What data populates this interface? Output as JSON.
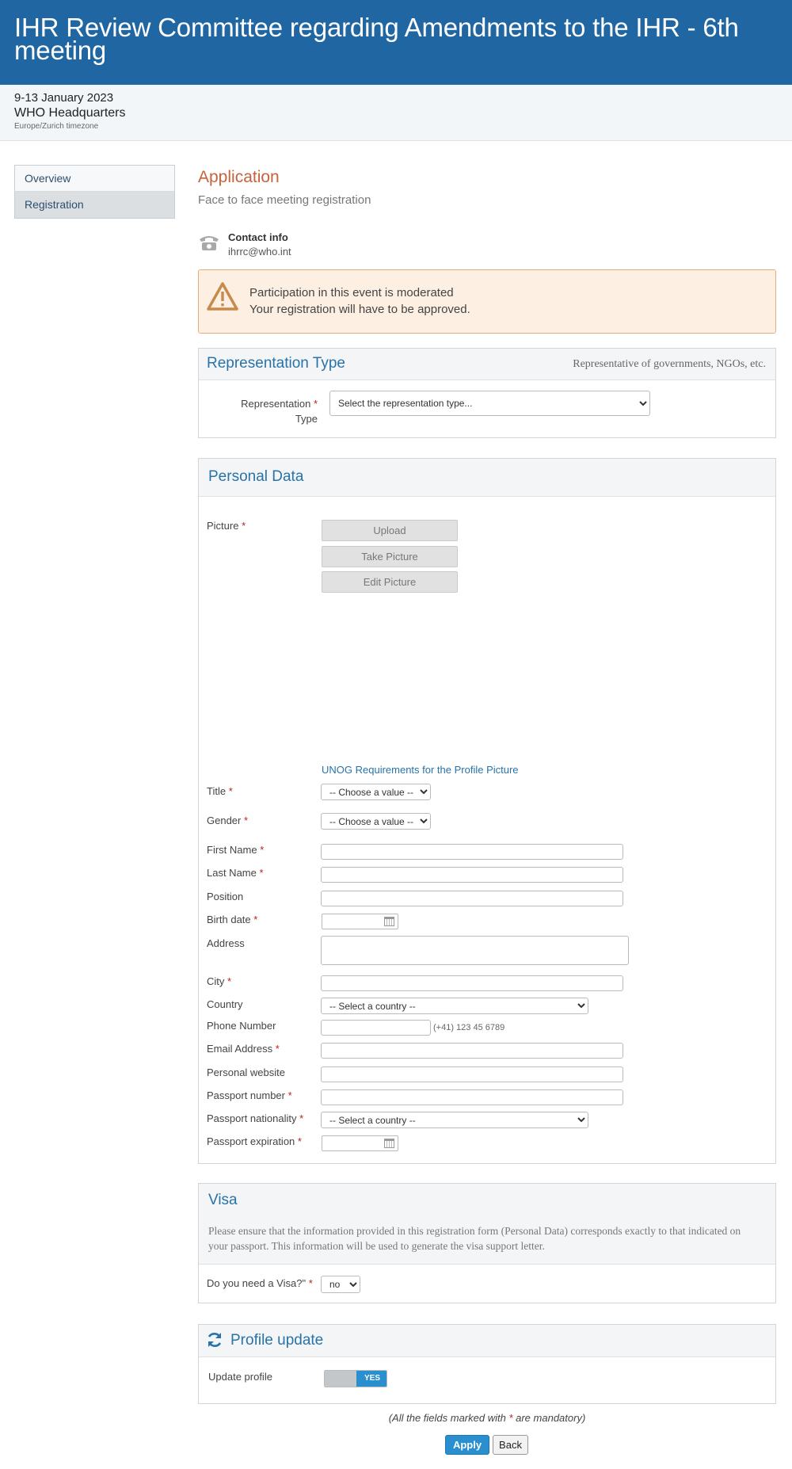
{
  "header": {
    "title": "IHR Review Committee regarding Amendments to the IHR - 6th meeting",
    "dates": "9-13 January 2023",
    "venue": "WHO Headquarters",
    "timezone": "Europe/Zurich timezone"
  },
  "sidebar": {
    "items": [
      {
        "label": "Overview",
        "active": false
      },
      {
        "label": "Registration",
        "active": true
      }
    ]
  },
  "main": {
    "title": "Application",
    "subtitle": "Face to face meeting registration",
    "contact": {
      "label": "Contact info",
      "email": "ihrrc@who.int"
    },
    "notice": {
      "line1": "Participation in this event is moderated",
      "line2": "Your registration will have to be approved."
    }
  },
  "representation": {
    "title": "Representation Type",
    "note": "Representative of governments, NGOs, etc.",
    "field_label": "Representation",
    "field_label2": "Type",
    "select_value": "Select the representation type..."
  },
  "personal": {
    "title": "Personal Data",
    "picture_label": "Picture",
    "upload": "Upload",
    "take_picture": "Take Picture",
    "edit_picture": "Edit Picture",
    "requirements_link": "UNOG Requirements for the Profile Picture",
    "title_label": "Title",
    "gender_label": "Gender",
    "choose_value": "-- Choose a value --",
    "first_name": "First Name",
    "last_name": "Last Name",
    "position": "Position",
    "birth_date": "Birth date",
    "address": "Address",
    "city": "City",
    "country": "Country",
    "select_country": "-- Select a country --",
    "phone": "Phone Number",
    "phone_hint": "(+41) 123 45 6789",
    "email": "Email Address",
    "website": "Personal website",
    "passport_number": "Passport number",
    "passport_nationality": "Passport nationality",
    "passport_expiration": "Passport expiration"
  },
  "visa": {
    "title": "Visa",
    "note": "Please ensure that the information provided in this registration form (Personal Data) corresponds exactly to that indicated on your passport. This information will be used to generate the visa support letter.",
    "question": "Do you need a Visa?\"",
    "value": "no"
  },
  "profile": {
    "title": "Profile update",
    "label": "Update profile",
    "toggle_on": "YES"
  },
  "footer": {
    "mandatory_prefix": "(All the fields marked with ",
    "mandatory_suffix": " are mandatory)",
    "apply": "Apply",
    "back": "Back"
  },
  "colors": {
    "header_bg": "#1f66a2",
    "accent": "#2873a8",
    "title_orange": "#c8623a",
    "warning_bg": "#fdf0e3",
    "button_blue": "#2a8fcf"
  }
}
